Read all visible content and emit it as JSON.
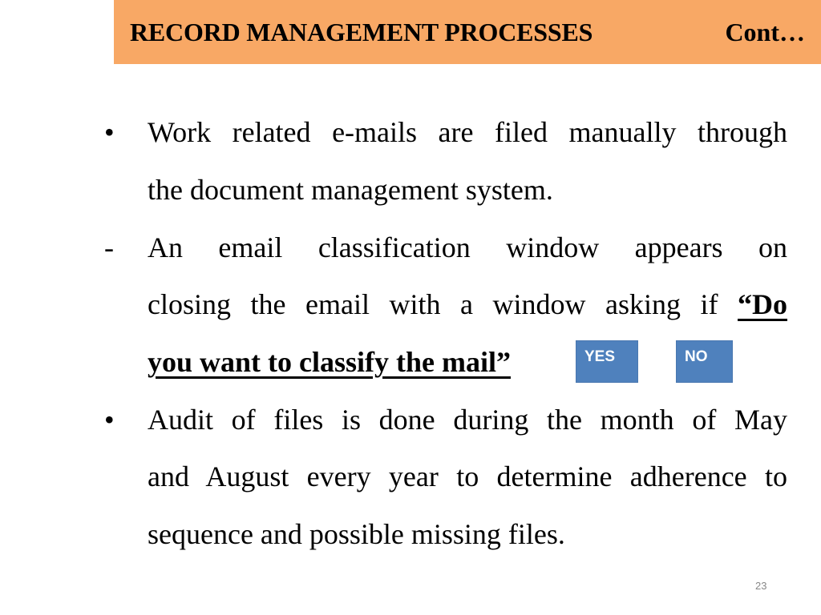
{
  "header": {
    "title": "RECORD MANAGEMENT PROCESSES",
    "continuation": "Cont…",
    "background_color": "#F8A865"
  },
  "content": {
    "bullet_marker": "•",
    "dash_marker": "-",
    "item1": {
      "line1": "Work related e-mails are filed manually through",
      "line2": "the document management system."
    },
    "item2": {
      "line1": "An email classification window appears on",
      "line2_plain": "closing the email with a window asking if ",
      "line2_bold": "“Do",
      "line3_bold": "you want to classify the mail”"
    },
    "item3": {
      "line1": "Audit of files is done during the month of May",
      "line2": "and August every year to determine adherence to",
      "line3": "sequence and possible missing files."
    }
  },
  "dialog_buttons": {
    "yes_label": "YES",
    "no_label": "NO",
    "color": "#4F81BD"
  },
  "footer": {
    "page_number": "23"
  }
}
